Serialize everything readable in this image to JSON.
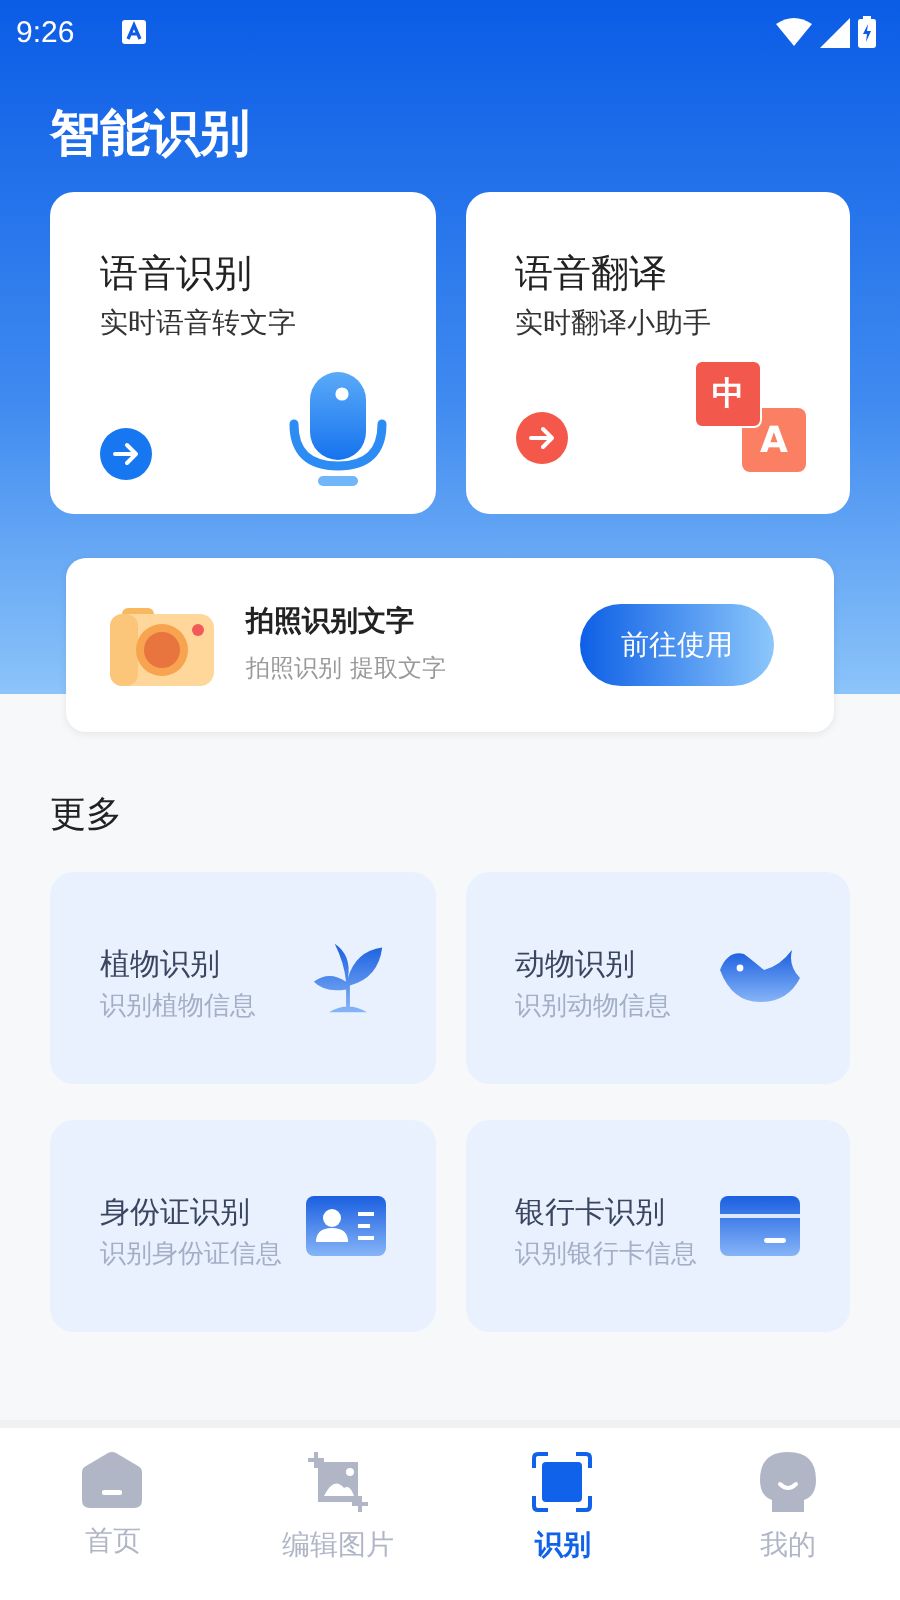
{
  "status_bar": {
    "time": "9:26"
  },
  "title": "智能识别",
  "main_cards": [
    {
      "kind": "mic",
      "title": "语音识别",
      "subtitle": "实时语音转文字",
      "color": "#1677f0"
    },
    {
      "kind": "translate",
      "title": "语音翻译",
      "subtitle": "实时翻译小助手",
      "color": "#f4584a",
      "icon_texts": [
        "中",
        "A"
      ]
    }
  ],
  "promo": {
    "title": "拍照识别文字",
    "subtitle": "拍照识别 提取文字",
    "button": "前往使用"
  },
  "more_heading": "更多",
  "features": [
    {
      "kind": "plant",
      "title": "植物识别",
      "subtitle": "识别植物信息"
    },
    {
      "kind": "bird",
      "title": "动物识别",
      "subtitle": "识别动物信息"
    },
    {
      "kind": "id",
      "title": "身份证识别",
      "subtitle": "识别身份证信息"
    },
    {
      "kind": "card",
      "title": "银行卡识别",
      "subtitle": "识别银行卡信息"
    }
  ],
  "tabs": [
    {
      "kind": "home",
      "label": "首页",
      "selected": false
    },
    {
      "kind": "edit",
      "label": "编辑图片",
      "selected": false
    },
    {
      "kind": "scan",
      "label": "识别",
      "selected": true
    },
    {
      "kind": "me",
      "label": "我的",
      "selected": false
    }
  ]
}
